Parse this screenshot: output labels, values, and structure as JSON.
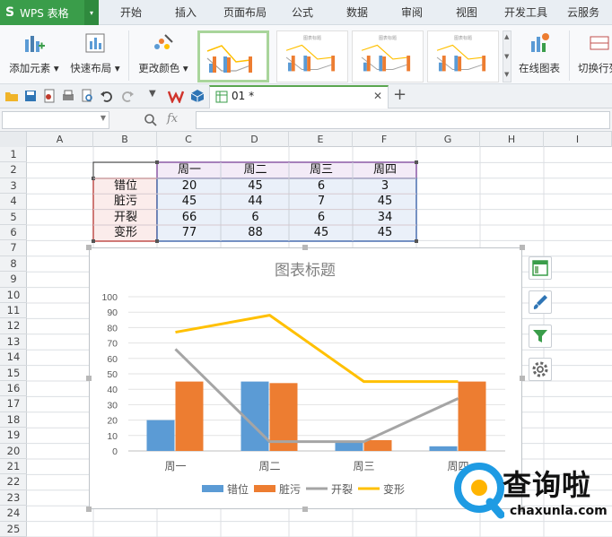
{
  "app": {
    "logo": "S",
    "name": "WPS 表格",
    "arrow": "▾"
  },
  "menu_tabs": [
    "开始",
    "插入",
    "页面布局",
    "公式",
    "数据",
    "审阅",
    "视图",
    "开发工具",
    "云服务"
  ],
  "ribbon": {
    "add_element": "添加元素 ▾",
    "quick_layout": "快速布局 ▾",
    "change_color": "更改颜色 ▾",
    "style_thumb_title": "图表标题",
    "online_chart": "在线图表",
    "switch_rowcol": "切换行列"
  },
  "doc_tab": {
    "name": "01 *",
    "close": "✕",
    "new": "+"
  },
  "formula_bar": {
    "namebox": "",
    "fx": "fx",
    "formula": ""
  },
  "columns": [
    "A",
    "B",
    "C",
    "D",
    "E",
    "F",
    "G",
    "H",
    "I"
  ],
  "rows": [
    "1",
    "2",
    "3",
    "4",
    "5",
    "6",
    "7",
    "8",
    "9",
    "10",
    "11",
    "12",
    "13",
    "14",
    "15",
    "16",
    "17",
    "18",
    "19",
    "20",
    "21",
    "22",
    "23",
    "24",
    "25"
  ],
  "table": {
    "headers": [
      "周一",
      "周二",
      "周三",
      "周四"
    ],
    "row_labels": [
      "错位",
      "脏污",
      "开裂",
      "变形"
    ],
    "values": [
      [
        "20",
        "45",
        "6",
        "3"
      ],
      [
        "45",
        "44",
        "7",
        "45"
      ],
      [
        "66",
        "6",
        "6",
        "34"
      ],
      [
        "77",
        "88",
        "45",
        "45"
      ]
    ]
  },
  "chart_data": {
    "type": "bar",
    "title": "图表标题",
    "categories": [
      "周一",
      "周二",
      "周三",
      "周四"
    ],
    "ylim": [
      0,
      100
    ],
    "yticks": [
      0,
      10,
      20,
      30,
      40,
      50,
      60,
      70,
      80,
      90,
      100
    ],
    "grid": true,
    "legend_position": "bottom",
    "series": [
      {
        "name": "错位",
        "type": "bar",
        "color": "#5b9bd5",
        "values": [
          20,
          45,
          6,
          3
        ]
      },
      {
        "name": "脏污",
        "type": "bar",
        "color": "#ed7d31",
        "values": [
          45,
          44,
          7,
          45
        ]
      },
      {
        "name": "开裂",
        "type": "line",
        "color": "#a5a5a5",
        "values": [
          66,
          6,
          6,
          34
        ]
      },
      {
        "name": "变形",
        "type": "line",
        "color": "#ffc000",
        "values": [
          77,
          88,
          45,
          45
        ]
      }
    ]
  },
  "side_buttons": [
    "chart-elements-icon",
    "chart-style-icon",
    "chart-filter-icon",
    "chart-settings-icon"
  ],
  "watermark": {
    "main": "查询啦",
    "sub": "chaxunla.com"
  }
}
